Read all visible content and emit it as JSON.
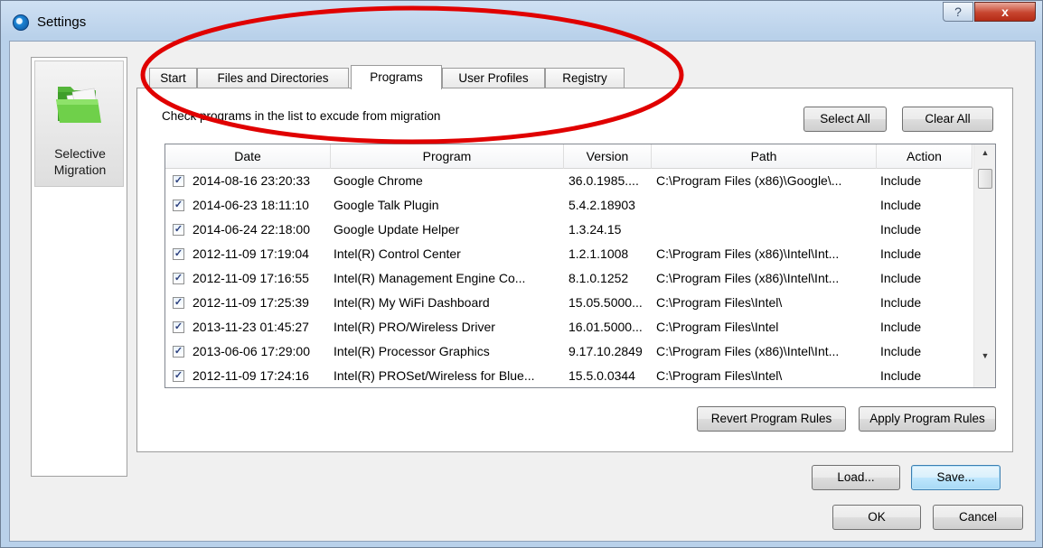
{
  "window": {
    "title": "Settings",
    "help_label": "?",
    "close_label": "x"
  },
  "nav": {
    "items": [
      {
        "label": "Selective\nMigration",
        "icon": "folder-icon"
      }
    ]
  },
  "tabs": [
    {
      "label": "Start"
    },
    {
      "label": "Files and Directories"
    },
    {
      "label": "Programs",
      "active": true
    },
    {
      "label": "User Profiles"
    },
    {
      "label": "Registry"
    }
  ],
  "programs": {
    "hint": "Check programs in the list to excude from migration",
    "select_all_label": "Select All",
    "clear_all_label": "Clear All",
    "columns": [
      "Date",
      "Program",
      "Version",
      "Path",
      "Action"
    ],
    "rows": [
      {
        "checked": true,
        "date": "2014-08-16 23:20:33",
        "program": "Google Chrome",
        "version": "36.0.1985....",
        "path": "C:\\Program Files (x86)\\Google\\...",
        "action": "Include"
      },
      {
        "checked": true,
        "date": "2014-06-23 18:11:10",
        "program": "Google Talk Plugin",
        "version": "5.4.2.18903",
        "path": "",
        "action": "Include"
      },
      {
        "checked": true,
        "date": "2014-06-24 22:18:00",
        "program": "Google Update Helper",
        "version": "1.3.24.15",
        "path": "",
        "action": "Include"
      },
      {
        "checked": true,
        "date": "2012-11-09 17:19:04",
        "program": "Intel(R) Control Center",
        "version": "1.2.1.1008",
        "path": "C:\\Program Files (x86)\\Intel\\Int...",
        "action": "Include"
      },
      {
        "checked": true,
        "date": "2012-11-09 17:16:55",
        "program": "Intel(R) Management Engine Co...",
        "version": "8.1.0.1252",
        "path": "C:\\Program Files (x86)\\Intel\\Int...",
        "action": "Include"
      },
      {
        "checked": true,
        "date": "2012-11-09 17:25:39",
        "program": "Intel(R) My WiFi Dashboard",
        "version": "15.05.5000...",
        "path": "C:\\Program Files\\Intel\\",
        "action": "Include"
      },
      {
        "checked": true,
        "date": "2013-11-23 01:45:27",
        "program": "Intel(R) PRO/Wireless Driver",
        "version": "16.01.5000...",
        "path": "C:\\Program Files\\Intel",
        "action": "Include"
      },
      {
        "checked": true,
        "date": "2013-06-06 17:29:00",
        "program": "Intel(R) Processor Graphics",
        "version": "9.17.10.2849",
        "path": "C:\\Program Files (x86)\\Intel\\Int...",
        "action": "Include"
      },
      {
        "checked": true,
        "date": "2012-11-09 17:24:16",
        "program": "Intel(R) PROSet/Wireless for Blue...",
        "version": "15.5.0.0344",
        "path": "C:\\Program Files\\Intel\\",
        "action": "Include"
      }
    ],
    "revert_label": "Revert Program Rules",
    "apply_label": "Apply Program Rules"
  },
  "footer": {
    "load_label": "Load...",
    "save_label": "Save...",
    "ok_label": "OK",
    "cancel_label": "Cancel"
  },
  "colors": {
    "annotation": "#e00000",
    "title_gradient_top": "#cfe0f3",
    "close_button": "#c7452f",
    "folder_green": "#5cbf3a"
  }
}
